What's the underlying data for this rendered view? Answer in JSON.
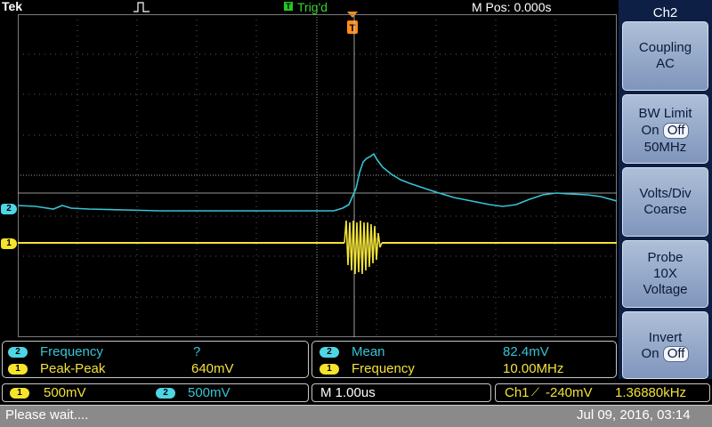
{
  "header": {
    "brand": "Tek",
    "trigger_status": "Trig'd",
    "trigger_icon_letter": "T",
    "horizontal_position": "M Pos: 0.000s",
    "trigger_position_marker": "T"
  },
  "channel_markers": {
    "ch2": "2",
    "ch1": "1"
  },
  "side_menu": {
    "title": "Ch2",
    "buttons": [
      {
        "line1": "Coupling",
        "line2": "AC"
      },
      {
        "line1": "BW Limit",
        "on": "On",
        "off": "Off",
        "line3": "50MHz"
      },
      {
        "line1": "Volts/Div",
        "line2": "Coarse"
      },
      {
        "line1": "Probe",
        "line2": "10X",
        "line3": "Voltage"
      },
      {
        "line1": "Invert",
        "on": "On",
        "off": "Off"
      }
    ]
  },
  "measurements_left": [
    {
      "channel": "2",
      "name": "Frequency",
      "value": "?"
    },
    {
      "channel": "1",
      "name": "Peak-Peak",
      "value": "640mV"
    }
  ],
  "measurements_right": [
    {
      "channel": "2",
      "name": "Mean",
      "value": "82.4mV"
    },
    {
      "channel": "1",
      "name": "Frequency",
      "value": "10.00MHz"
    }
  ],
  "vertical": {
    "ch1_badge": "1",
    "ch1_scale": "500mV",
    "ch2_badge": "2",
    "ch2_scale": "500mV"
  },
  "horizontal": {
    "timebase": "M 1.00us"
  },
  "trigger": {
    "source": "Ch1",
    "slope_symbol": "⟋",
    "level": "-240mV",
    "frequency": "1.36880kHz"
  },
  "status": {
    "message": "Please wait....",
    "datetime": "Jul 09, 2016, 03:14"
  },
  "colors": {
    "ch1": "#f2e23a",
    "ch2": "#36c4d4",
    "menu_bg": "#0d1f44",
    "trigger": "#ff8c1a"
  }
}
